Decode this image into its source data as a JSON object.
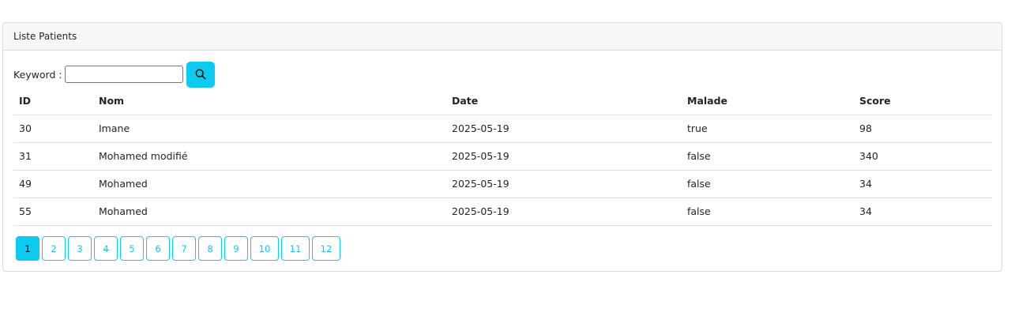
{
  "card": {
    "title": "Liste Patients"
  },
  "search": {
    "label": "Keyword :",
    "value": "",
    "placeholder": "",
    "button_icon": "search-icon"
  },
  "table": {
    "headers": {
      "id": "ID",
      "nom": "Nom",
      "date": "Date",
      "malade": "Malade",
      "score": "Score"
    },
    "rows": [
      {
        "id": "30",
        "nom": "Imane",
        "date": "2025-05-19",
        "malade": "true",
        "score": "98"
      },
      {
        "id": "31",
        "nom": "Mohamed modifié",
        "date": "2025-05-19",
        "malade": "false",
        "score": "340"
      },
      {
        "id": "49",
        "nom": "Mohamed",
        "date": "2025-05-19",
        "malade": "false",
        "score": "34"
      },
      {
        "id": "55",
        "nom": "Mohamed",
        "date": "2025-05-19",
        "malade": "false",
        "score": "34"
      }
    ]
  },
  "pagination": {
    "current": "1",
    "pages": [
      "1",
      "2",
      "3",
      "4",
      "5",
      "6",
      "7",
      "8",
      "9",
      "10",
      "11",
      "12"
    ]
  },
  "colors": {
    "accent": "#0dcaf0",
    "header_bg": "#f7f7f7",
    "border": "#dee2e6"
  }
}
